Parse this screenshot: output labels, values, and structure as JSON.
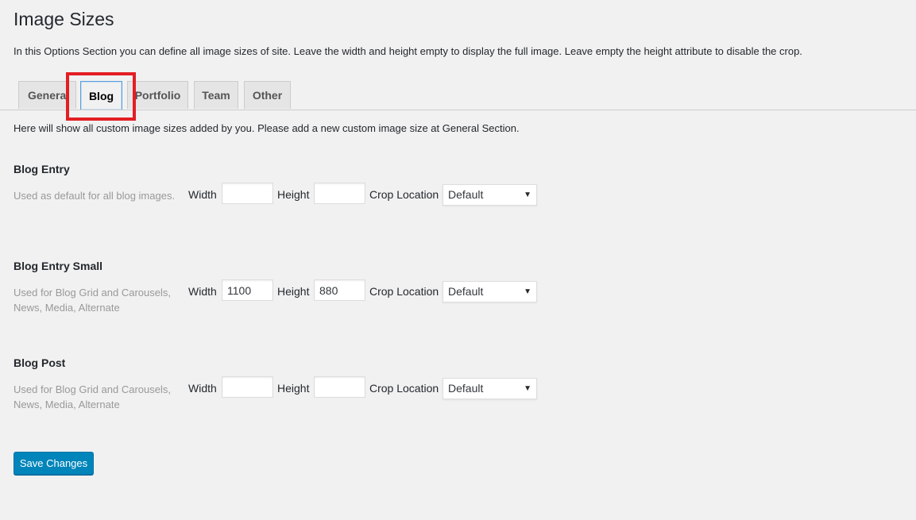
{
  "page": {
    "title": "Image Sizes",
    "intro": "In this Options Section you can define all image sizes of site. Leave the width and height empty to display the full image. Leave empty the height attribute to disable the crop.",
    "notice": "Here will show all custom image sizes added by you. Please add a new custom image size at General Section."
  },
  "tabs": [
    {
      "label": "General",
      "active": false
    },
    {
      "label": "Blog",
      "active": true
    },
    {
      "label": "Portfolio",
      "active": false
    },
    {
      "label": "Team",
      "active": false
    },
    {
      "label": "Other",
      "active": false
    }
  ],
  "labels": {
    "width": "Width",
    "height": "Height",
    "crop": "Crop Location"
  },
  "sections": [
    {
      "title": "Blog Entry",
      "description": "Used as default for all blog images.",
      "width": "",
      "height": "",
      "crop": "Default"
    },
    {
      "title": "Blog Entry Small",
      "description": "Used for Blog Grid and Carousels, News, Media, Alternate",
      "width": "1100",
      "height": "880",
      "crop": "Default"
    },
    {
      "title": "Blog Post",
      "description": "Used for Blog Grid and Carousels, News, Media, Alternate",
      "width": "",
      "height": "",
      "crop": "Default"
    }
  ],
  "icons": {
    "dropdown": "chevron-down-icon",
    "dropdown_glyph": "▼"
  },
  "colors": {
    "primary_button": "#0085ba",
    "highlight": "#e31e24",
    "active_tab_border": "#5b9dd9"
  },
  "actions": {
    "save_label": "Save Changes"
  }
}
